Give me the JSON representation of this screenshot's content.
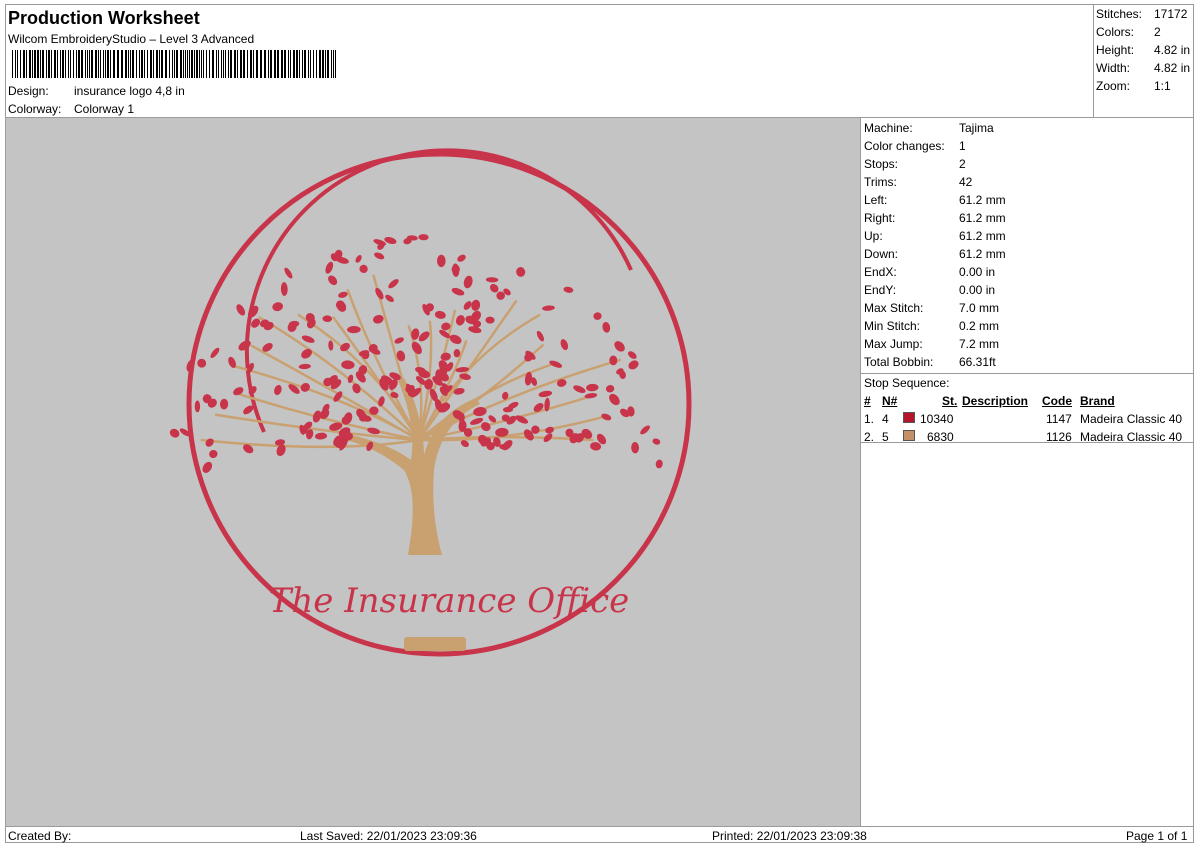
{
  "header": {
    "title": "Production Worksheet",
    "subtitle": "Wilcom EmbroideryStudio – Level 3 Advanced",
    "design_label": "Design:",
    "design_value": "insurance logo 4,8 in",
    "colorway_label": "Colorway:",
    "colorway_value": "Colorway 1"
  },
  "stats": [
    {
      "label": "Stitches:",
      "value": "17172"
    },
    {
      "label": "Colors:",
      "value": "2"
    },
    {
      "label": "Height:",
      "value": "4.82 in"
    },
    {
      "label": "Width:",
      "value": "4.82 in"
    },
    {
      "label": "Zoom:",
      "value": "1:1"
    }
  ],
  "machine_info": [
    {
      "label": "Machine:",
      "value": "Tajima"
    },
    {
      "label": "Color changes:",
      "value": "1"
    },
    {
      "label": "Stops:",
      "value": "2"
    },
    {
      "label": "Trims:",
      "value": "42"
    },
    {
      "label": "Left:",
      "value": "61.2 mm"
    },
    {
      "label": "Right:",
      "value": "61.2 mm"
    },
    {
      "label": "Up:",
      "value": "61.2 mm"
    },
    {
      "label": "Down:",
      "value": "61.2 mm"
    },
    {
      "label": "EndX:",
      "value": "0.00 in"
    },
    {
      "label": "EndY:",
      "value": "0.00 in"
    },
    {
      "label": "Max Stitch:",
      "value": "7.0 mm"
    },
    {
      "label": "Min Stitch:",
      "value": "0.2 mm"
    },
    {
      "label": "Max Jump:",
      "value": "7.2 mm"
    },
    {
      "label": "Total Bobbin:",
      "value": "66.31ft"
    }
  ],
  "stop_sequence": {
    "title": "Stop Sequence:",
    "headers": {
      "num": "#",
      "n": "N#",
      "st": "St.",
      "description": "Description",
      "code": "Code",
      "brand": "Brand"
    },
    "rows": [
      {
        "num": "1.",
        "n": "4",
        "color": "#b5152c",
        "st": "10340",
        "description": "",
        "code": "1147",
        "brand": "Madeira Classic 40"
      },
      {
        "num": "2.",
        "n": "5",
        "color": "#c49068",
        "st": "6830",
        "description": "",
        "code": "1126",
        "brand": "Madeira Classic 40"
      }
    ]
  },
  "design_preview": {
    "text": "The Insurance Office",
    "colors": {
      "red": "#c8344a",
      "gold": "#c9a070"
    }
  },
  "footer": {
    "created_by": "Created By:",
    "last_saved": "Last Saved: 22/01/2023 23:09:36",
    "printed": "Printed: 22/01/2023 23:09:38",
    "page": "Page 1 of 1"
  }
}
